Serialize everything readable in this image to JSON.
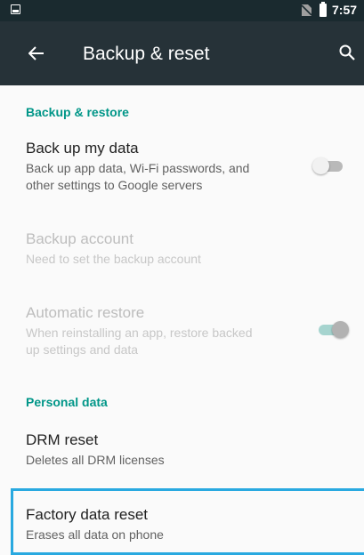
{
  "status_bar": {
    "time": "7:57",
    "icons": [
      "image-notification-icon",
      "no-sim-icon",
      "battery-icon"
    ]
  },
  "app_bar": {
    "title": "Backup & reset",
    "back_icon": "arrow-left-icon",
    "search_icon": "search-icon"
  },
  "sections": {
    "backup_restore": {
      "header": "Backup & restore",
      "back_up_my_data": {
        "title": "Back up my data",
        "summary_line1": "Back up app data, Wi-Fi passwords, and",
        "summary_line2": "other settings to Google servers",
        "toggle_on": false,
        "enabled": true
      },
      "backup_account": {
        "title": "Backup account",
        "summary": "Need to set the backup account",
        "enabled": false
      },
      "automatic_restore": {
        "title": "Automatic restore",
        "summary_line1": "When reinstalling an app, restore backed",
        "summary_line2": "up settings and data",
        "toggle_on": true,
        "enabled": false
      }
    },
    "personal_data": {
      "header": "Personal data",
      "drm_reset": {
        "title": "DRM reset",
        "summary": "Deletes all DRM licenses"
      },
      "factory_data_reset": {
        "title": "Factory data reset",
        "summary": "Erases all data on phone",
        "highlighted": true
      }
    }
  },
  "colors": {
    "status_bar_bg": "#1a2a2f",
    "app_bar_bg": "#263238",
    "accent": "#009688",
    "highlight": "#29a9e0"
  }
}
